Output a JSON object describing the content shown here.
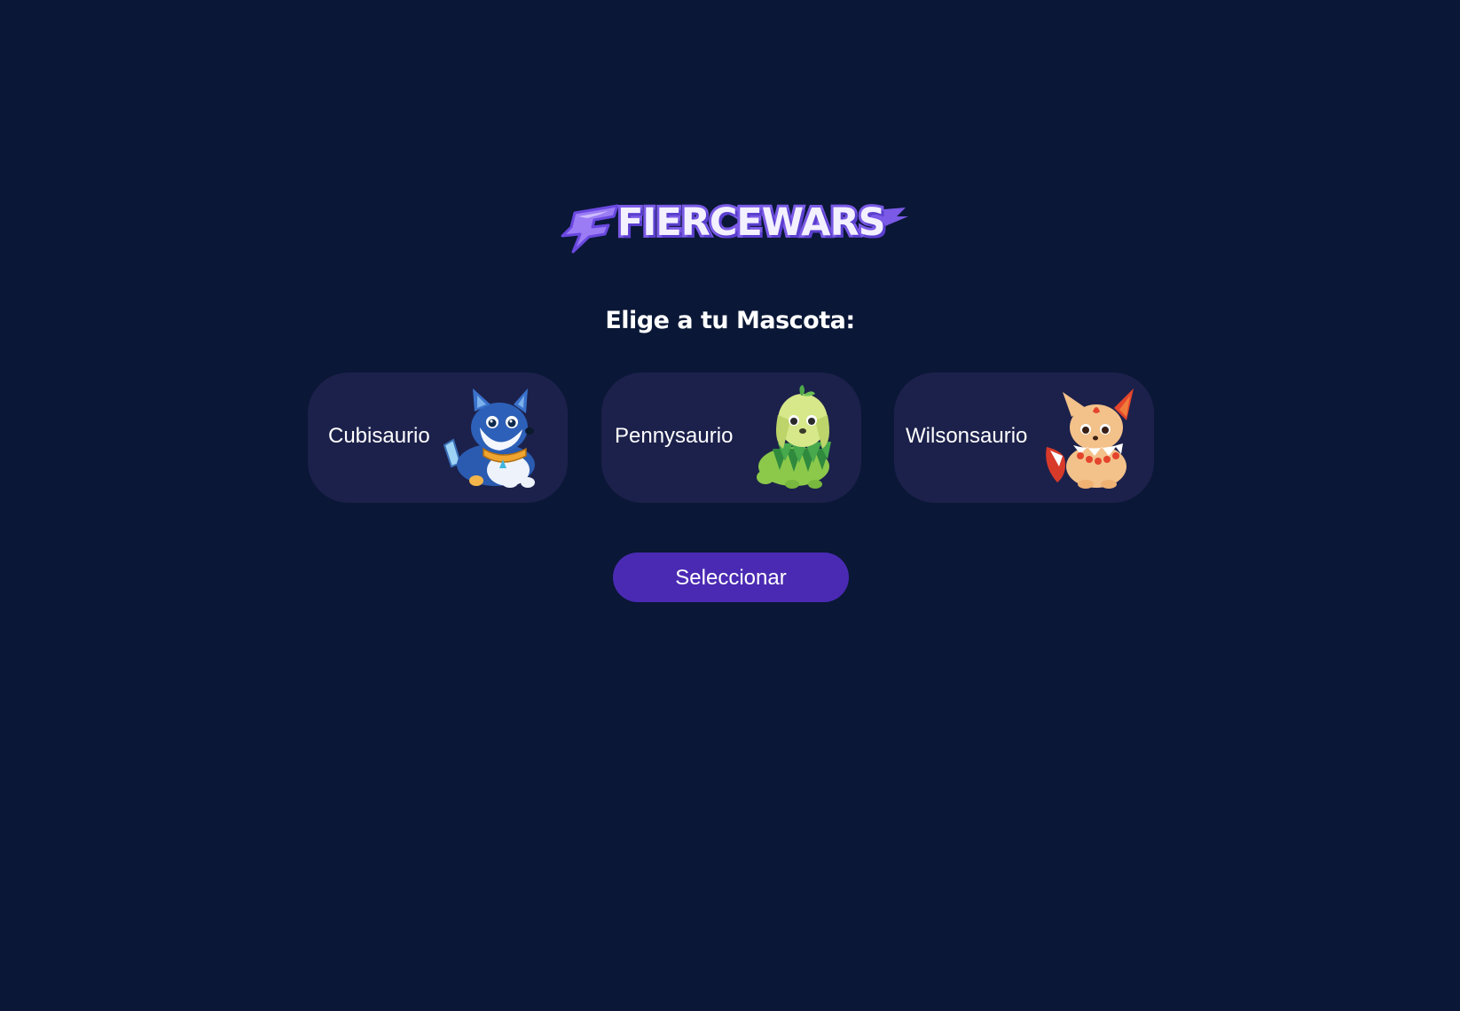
{
  "brand": {
    "logo_text": "FIERCEWARS"
  },
  "heading": "Elige a tu Mascota:",
  "pets": [
    {
      "name": "Cubisaurio",
      "icon": "blue-wolf-pet-icon"
    },
    {
      "name": "Pennysaurio",
      "icon": "green-leaf-dog-pet-icon"
    },
    {
      "name": "Wilsonsaurio",
      "icon": "orange-fire-fox-pet-icon"
    }
  ],
  "actions": {
    "select_label": "Seleccionar"
  },
  "colors": {
    "background": "#0a1736",
    "card": "#1c214b",
    "button": "#4a2ab3",
    "logo_accent": "#7a5ae6"
  }
}
